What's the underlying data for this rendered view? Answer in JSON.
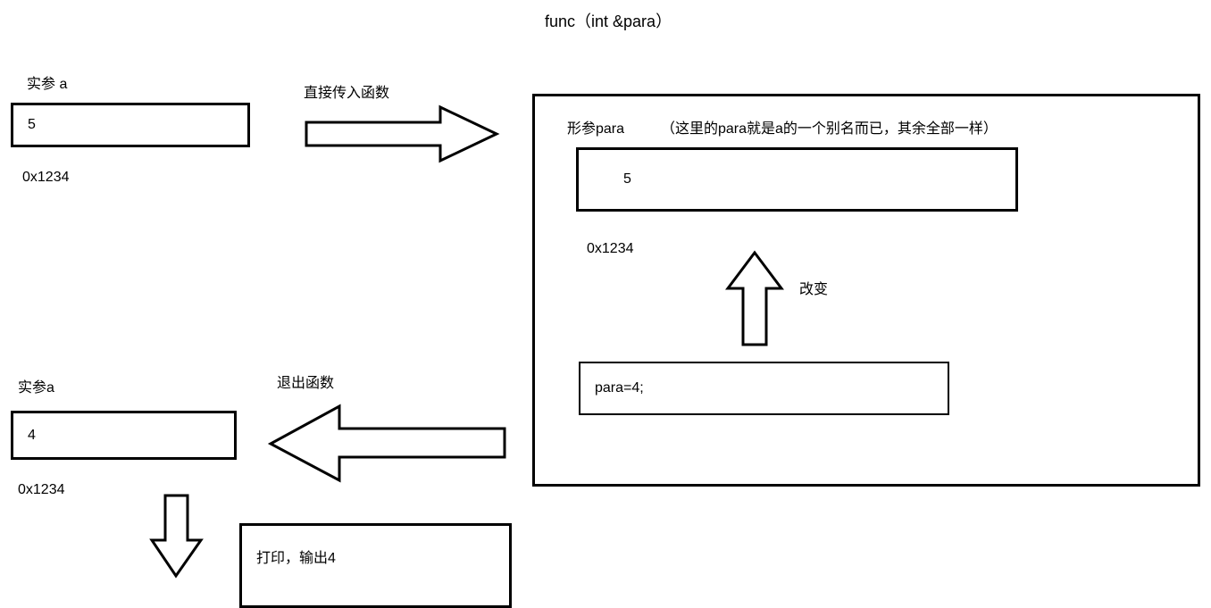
{
  "header": {
    "func_signature": "func（int &para）"
  },
  "left_top": {
    "label_a": "实参 a",
    "value": "5",
    "address": "0x1234",
    "arrow_label": "直接传入函数"
  },
  "right_box": {
    "label_para": "形参para",
    "note": "（这里的para就是a的一个别名而已，其余全部一样）",
    "value": "5",
    "address": "0x1234",
    "change_label": "改变",
    "assignment": "para=4;"
  },
  "left_bottom": {
    "label_a": "实参a",
    "arrow_label": "退出函数",
    "value": "4",
    "address": "0x1234",
    "print_label": "打印，输出4"
  }
}
